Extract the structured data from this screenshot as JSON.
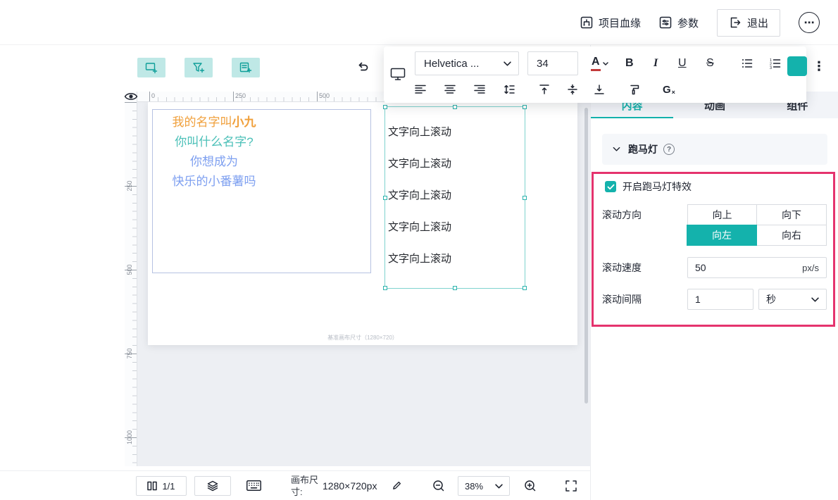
{
  "colors": {
    "accent_teal": "#14b2ac",
    "highlight_pink": "#e5336e",
    "orange_text": "#f0a03c",
    "teal_text": "#4cc0b8",
    "blue_text": "#7d9ff0"
  },
  "icons": {
    "more_horizontal": "⋯",
    "more_vertical": "⋮"
  },
  "header": {
    "lineage_label": "项目血缘",
    "params_label": "参数",
    "exit_label": "退出"
  },
  "text_toolbar": {
    "font_name": "Helvetica ...",
    "font_size": "34",
    "color_letter": "A",
    "bold": "B",
    "italic": "I",
    "underline": "U",
    "strike": "S",
    "clear_letter": "G",
    "clear_x": "×"
  },
  "ruler": {
    "h": [
      "0",
      "250",
      "500"
    ],
    "v": [
      "250",
      "500",
      "750",
      "1000"
    ]
  },
  "artboard": {
    "greeting": {
      "line1_prefix": "我的名字叫",
      "line1_bold": "小九",
      "line2": "你叫什么名字?",
      "line3": "你想成为",
      "line4": "快乐的小番薯吗"
    },
    "marquee_lines": [
      "文字向上滚动",
      "文字向上滚动",
      "文字向上滚动",
      "文字向上滚动",
      "文字向上滚动"
    ],
    "footnote": "基准画布尺寸（1280×720）"
  },
  "panel": {
    "tabs": [
      "内容",
      "动画",
      "组件"
    ],
    "active_tab": "内容",
    "section_title": "跑马灯",
    "enable_label": "开启跑马灯特效",
    "direction_label": "滚动方向",
    "directions": [
      "向上",
      "向下",
      "向左",
      "向右"
    ],
    "selected_direction": "向左",
    "speed_label": "滚动速度",
    "speed_value": "50",
    "speed_unit": "px/s",
    "interval_label": "滚动间隔",
    "interval_value": "1",
    "interval_unit": "秒"
  },
  "bottom_bar": {
    "page_indicator": "1/1",
    "canvas_size_label": "画布尺寸:",
    "canvas_size_value": "1280×720px",
    "zoom_value": "38%"
  }
}
